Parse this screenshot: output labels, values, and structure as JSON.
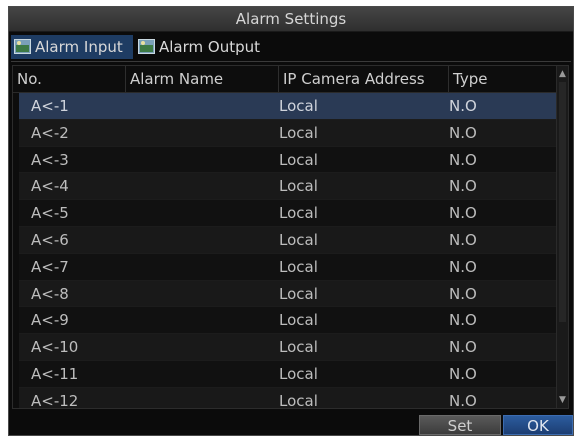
{
  "window": {
    "title": "Alarm Settings"
  },
  "tabs": [
    {
      "label": "Alarm Input",
      "active": true,
      "icon": "camera-icon"
    },
    {
      "label": "Alarm Output",
      "active": false,
      "icon": "camera-icon"
    }
  ],
  "table": {
    "columns": [
      "No.",
      "Alarm Name",
      "IP Camera Address",
      "Type"
    ],
    "rows": [
      {
        "no": "A<-1",
        "name": "",
        "address": "Local",
        "type": "N.O",
        "selected": true
      },
      {
        "no": "A<-2",
        "name": "",
        "address": "Local",
        "type": "N.O"
      },
      {
        "no": "A<-3",
        "name": "",
        "address": "Local",
        "type": "N.O"
      },
      {
        "no": "A<-4",
        "name": "",
        "address": "Local",
        "type": "N.O"
      },
      {
        "no": "A<-5",
        "name": "",
        "address": "Local",
        "type": "N.O"
      },
      {
        "no": "A<-6",
        "name": "",
        "address": "Local",
        "type": "N.O"
      },
      {
        "no": "A<-7",
        "name": "",
        "address": "Local",
        "type": "N.O"
      },
      {
        "no": "A<-8",
        "name": "",
        "address": "Local",
        "type": "N.O"
      },
      {
        "no": "A<-9",
        "name": "",
        "address": "Local",
        "type": "N.O"
      },
      {
        "no": "A<-10",
        "name": "",
        "address": "Local",
        "type": "N.O"
      },
      {
        "no": "A<-11",
        "name": "",
        "address": "Local",
        "type": "N.O"
      },
      {
        "no": "A<-12",
        "name": "",
        "address": "Local",
        "type": "N.O"
      }
    ]
  },
  "buttons": {
    "set": "Set",
    "ok": "OK"
  },
  "colors": {
    "accent": "#1e3c63",
    "selected_row": "#2a3a55",
    "background": "#0b0b0b"
  }
}
